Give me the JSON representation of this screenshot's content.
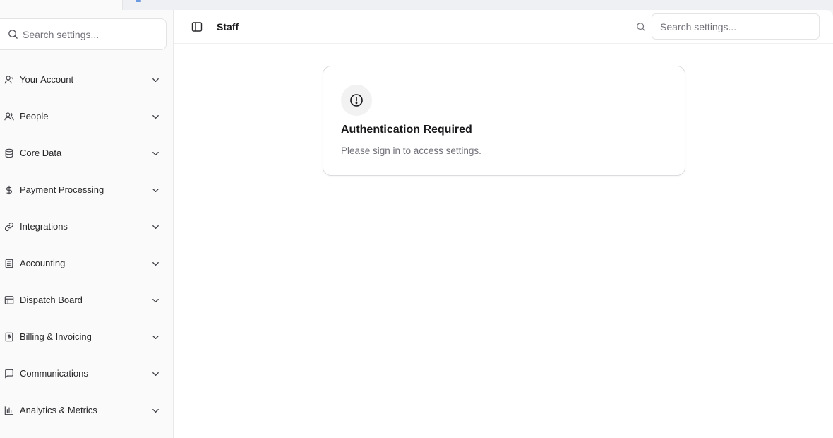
{
  "sidebar": {
    "search": {
      "placeholder": "Search settings..."
    },
    "items": [
      {
        "label": "Your Account",
        "icon": "user-icon"
      },
      {
        "label": "People",
        "icon": "users-icon"
      },
      {
        "label": "Core Data",
        "icon": "database-icon"
      },
      {
        "label": "Payment Processing",
        "icon": "dollar-icon"
      },
      {
        "label": "Integrations",
        "icon": "link-icon"
      },
      {
        "label": "Accounting",
        "icon": "calculator-icon"
      },
      {
        "label": "Dispatch Board",
        "icon": "layout-icon"
      },
      {
        "label": "Billing & Invoicing",
        "icon": "receipt-icon"
      },
      {
        "label": "Communications",
        "icon": "message-icon"
      },
      {
        "label": "Analytics & Metrics",
        "icon": "bar-chart-icon"
      }
    ]
  },
  "header": {
    "title": "Staff",
    "search_placeholder": "Search settings..."
  },
  "card": {
    "title": "Authentication Required",
    "message": "Please sign in to access settings.",
    "icon": "alert-circle-icon"
  },
  "colors": {
    "sidebar_bg": "#fafafa",
    "main_bg": "#ffffff",
    "muted_text": "#71717a"
  }
}
